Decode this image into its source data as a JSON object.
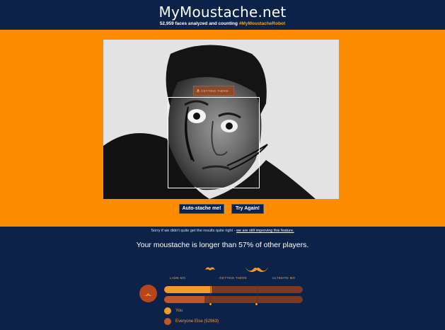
{
  "header": {
    "title": "MyMoustache.net",
    "tagline_prefix": "52,959 faces analyzed and counting",
    "hashtag": "#MyMoustacheRobot"
  },
  "photo": {
    "rating_tag": "GETTING THERE",
    "description_icon": "mini-moustache-icon"
  },
  "actions": {
    "auto_stache_label": "Auto-stache me!",
    "try_again_label": "Try Again!"
  },
  "notice": {
    "text": "Sorry if we didn't quite get the results quite right - ",
    "link_text": "we are still improving this feature."
  },
  "result": {
    "text": "Your moustache is longer than 57% of other players."
  },
  "scale": {
    "labels": [
      "LAME MO",
      "GETTING THERE",
      "ULTIMATE MO"
    ]
  },
  "comparison": {
    "you_label": "You",
    "everyone_label": "Everyone Else (52963)",
    "you_fraction": 0.34,
    "everyone_fraction": 0.29
  },
  "colors": {
    "navy": "#0d2248",
    "orange": "#ff8c00",
    "bar_track": "#7a3a22",
    "you_color": "#f29a2e",
    "everyone_color": "#c0572a"
  }
}
